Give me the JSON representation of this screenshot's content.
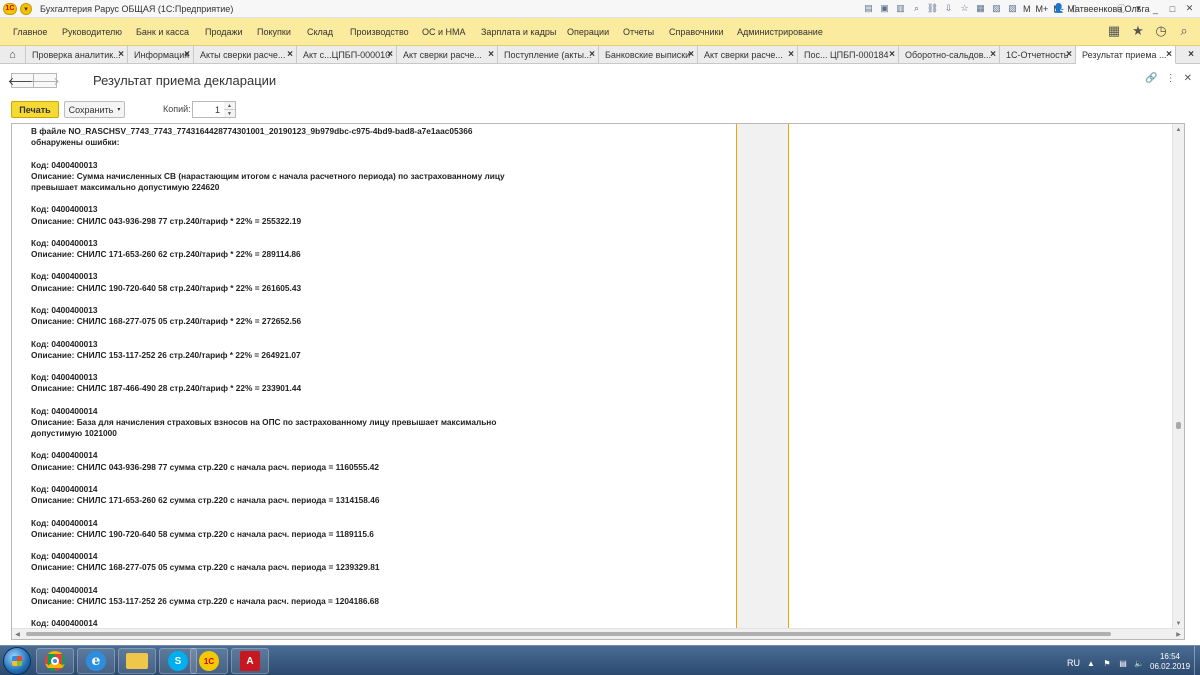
{
  "window": {
    "title": "Бухгалтерия Рарус ОБЩАЯ  (1С:Предприятие)",
    "toolbar_m_labels": [
      "M",
      "M+",
      "M-"
    ],
    "user": "Матвеенкова Ольга"
  },
  "main_menu": [
    "Главное",
    "Руководителю",
    "Банк и касса",
    "Продажи",
    "Покупки",
    "Склад",
    "Производство",
    "ОС и НМА",
    "Зарплата и кадры",
    "Операции",
    "Отчеты",
    "Справочники",
    "Администрирование"
  ],
  "tabs": [
    "Проверка аналитик...",
    "Информация",
    "Акты сверки расче...",
    "Акт с...ЦПБП-000010",
    "Акт сверки расче...",
    "Поступление (акты...",
    "Банковские выписки",
    "Акт сверки расче...",
    "Пос... ЦПБП-000184",
    "Оборотно-сальдов...",
    "1С-Отчетность",
    "Результат приема ..."
  ],
  "form": {
    "title": "Результат приема декларации",
    "print_label": "Печать",
    "save_label": "Сохранить",
    "copies_label": "Копий:",
    "copies_value": "1"
  },
  "document": {
    "lines": [
      "В файле NO_RASCHSV_7743_7743_7743164428774301001_20190123_9b979dbc-c975-4bd9-bad8-a7e1aac05366",
      "обнаружены ошибки:",
      "",
      "Код: 0400400013",
      "Описание: Сумма начисленных СВ (нарастающим итогом с начала расчетного периода) по застрахованному лицу",
      "превышает максимально допустимую 224620",
      "",
      "Код: 0400400013",
      "Описание: СНИЛС 043-936-298 77 стр.240/тариф * 22% = 255322.19",
      "",
      "Код: 0400400013",
      "Описание: СНИЛС 171-653-260 62 стр.240/тариф * 22% = 289114.86",
      "",
      "Код: 0400400013",
      "Описание: СНИЛС 190-720-640 58 стр.240/тариф * 22% = 261605.43",
      "",
      "Код: 0400400013",
      "Описание: СНИЛС 168-277-075 05 стр.240/тариф * 22% = 272652.56",
      "",
      "Код: 0400400013",
      "Описание: СНИЛС 153-117-252 26 стр.240/тариф * 22% = 264921.07",
      "",
      "Код: 0400400013",
      "Описание: СНИЛС 187-466-490 28 стр.240/тариф * 22% = 233901.44",
      "",
      "Код: 0400400014",
      "Описание: База для начисления страховых взносов на ОПС по застрахованному лицу превышает максимально",
      "допустимую 1021000",
      "",
      "Код: 0400400014",
      "Описание: СНИЛС 043-936-298 77 сумма стр.220 с начала расч. периода = 1160555.42",
      "",
      "Код: 0400400014",
      "Описание: СНИЛС 171-653-260 62 сумма стр.220 с начала расч. периода = 1314158.46",
      "",
      "Код: 0400400014",
      "Описание: СНИЛС 190-720-640 58 сумма стр.220 с начала расч. периода = 1189115.6",
      "",
      "Код: 0400400014",
      "Описание: СНИЛС 168-277-075 05 сумма стр.220 с начала расч. периода = 1239329.81",
      "",
      "Код: 0400400014",
      "Описание: СНИЛС 153-117-252 26 сумма стр.220 с начала расч. периода = 1204186.68",
      "",
      "Код: 0400400014"
    ]
  },
  "taskbar": {
    "apps": [
      "chrome",
      "internet-explorer",
      "file-explorer",
      "skype",
      "1c",
      "acrobat"
    ],
    "language": "RU",
    "time": "16:54",
    "date": "06.02.2019"
  }
}
